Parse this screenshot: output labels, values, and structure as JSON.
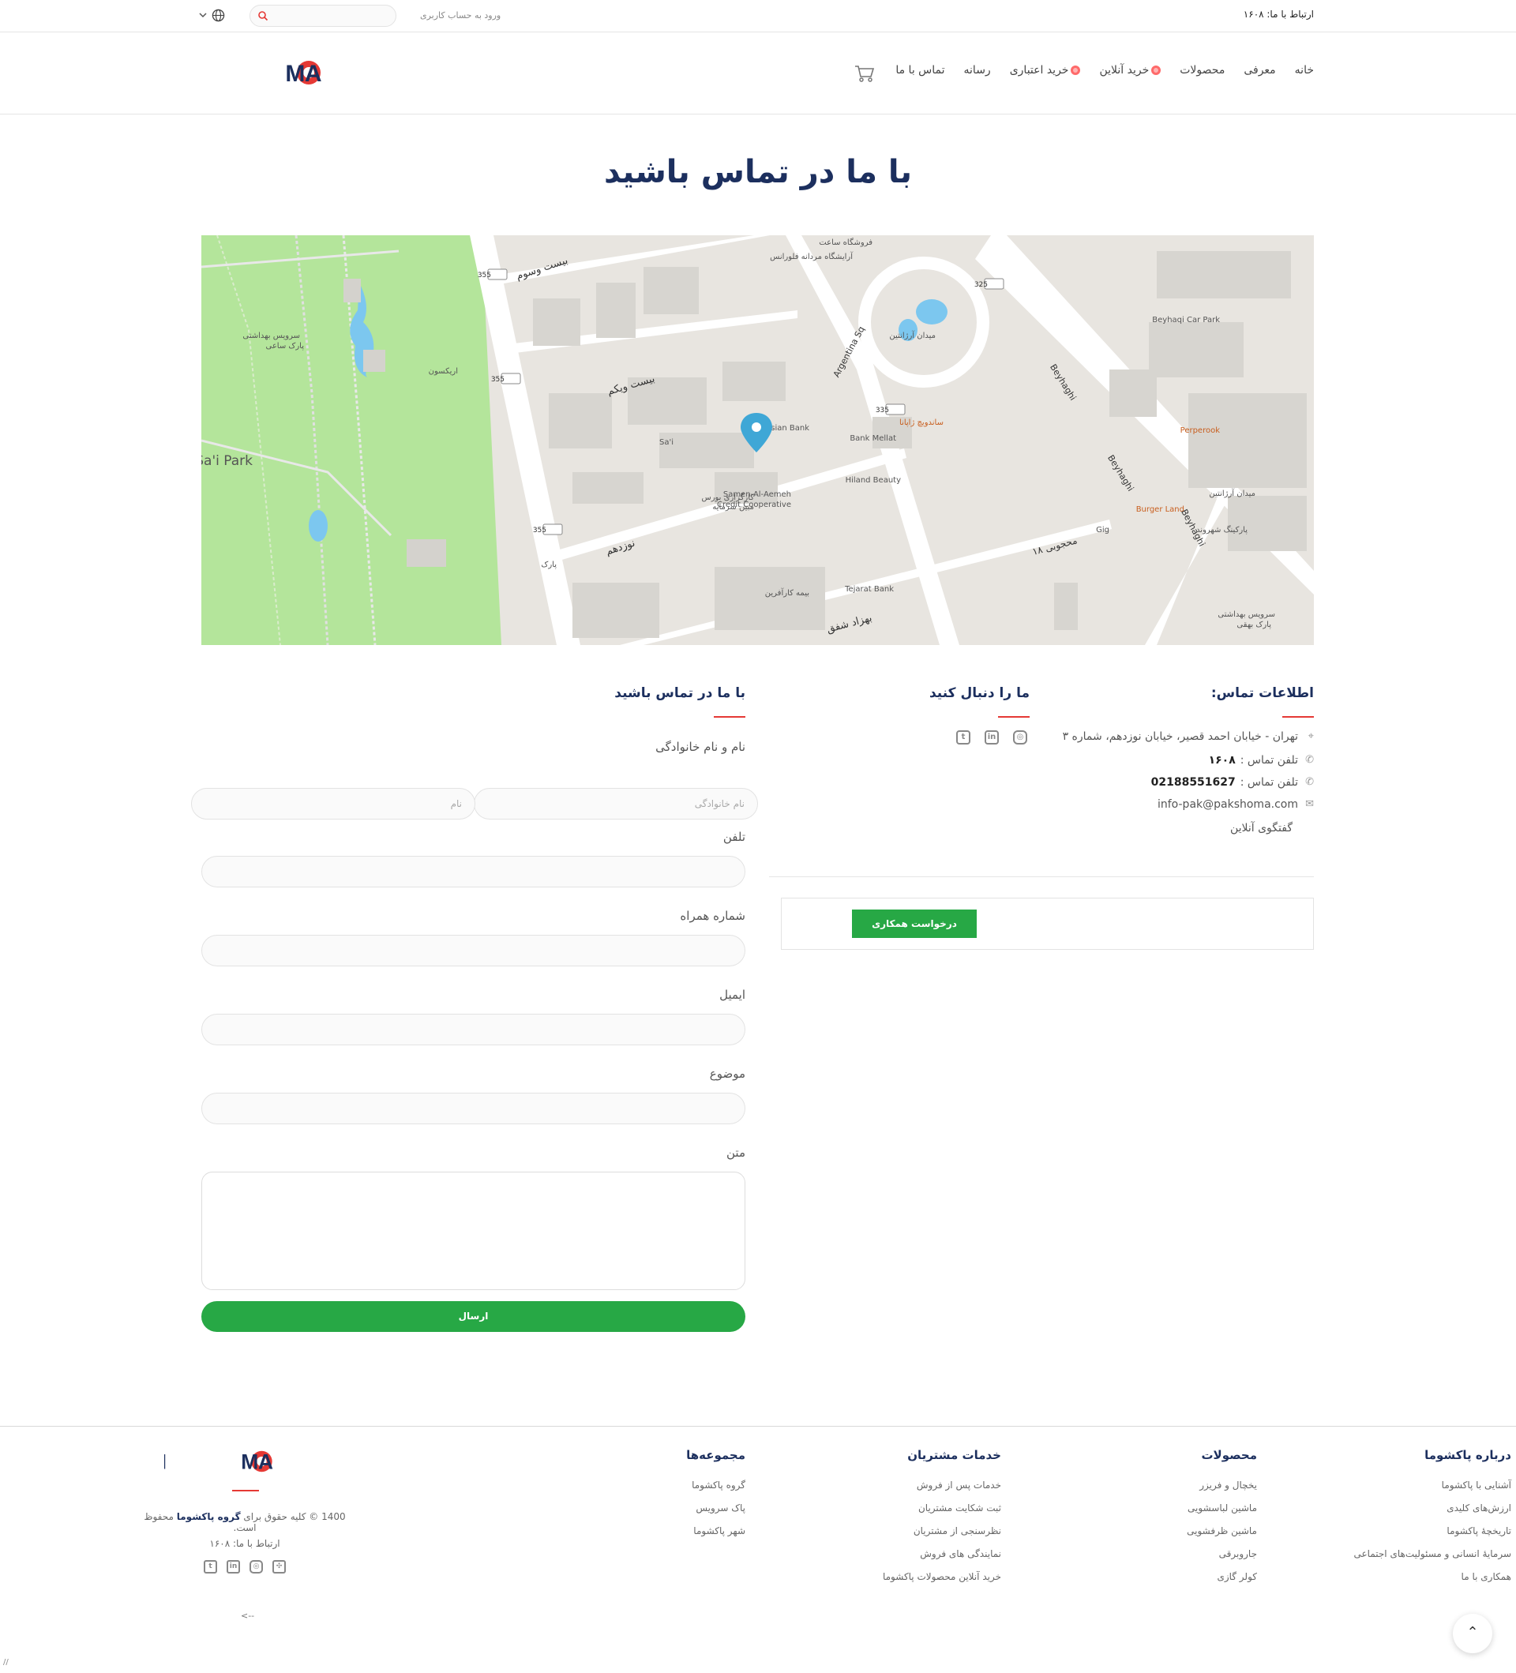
{
  "topbar": {
    "contact": "ارتباط با ما: ۱۶۰۸",
    "login": "ورود به حساب کاربری",
    "search_placeholder": ""
  },
  "nav": {
    "items": [
      "خانه",
      "معرفی",
      "محصولات",
      "خرید آنلاین",
      "خرید اعتباری",
      "رسانه",
      "تماس با ما"
    ],
    "brand": "PAKSHOMA"
  },
  "page_title": "با ما در تماس باشید",
  "map": {
    "labels": {
      "sai_park": "Sa'i Park",
      "sai": "Sa'i",
      "parsian": "Parsian Bank",
      "mellat": "Bank Mellat",
      "hiland": "Hiland Beauty",
      "samen": "Samen-Al-Aemeh",
      "samen2": "Credit Cooperative",
      "tejarat": "Tejarat Bank",
      "beyhaqi_park": "Beyhaqi Car Park",
      "perperook": "Perperook",
      "burger": "Burger Land",
      "gig": "Gig",
      "argentina": "Argentina Sq",
      "beyhaghi": "Beyhaghi",
      "st20": "بیست وسوم",
      "st21": "بیست ویکم",
      "st19": "نوزدهم",
      "behzad": "بهزاد شفق",
      "mahjubi": "محجوبی ۱۸",
      "meydan": "میدان آرژانتین",
      "park_sai_wc": "سرویس بهداشتی",
      "park_sai_wc2": "پارک ساعی",
      "arikson": "اریکسون",
      "store": "فروشگاه ساعت",
      "hair": "آرایشگاه مردانه فلورانس",
      "sandwich": "ساندویچ ژاپانا",
      "meydan2": "میدان آرژانتین",
      "parking": "پارکینگ شهروند",
      "bourse": "کارگزاری بورس",
      "bourse2": "مبین سرمایه",
      "bime": "بیمه کارآفرین",
      "park": "پارک",
      "wc2": "سرویس بهداشتی",
      "wc2b": "پارک بهقی",
      "r355a": "355",
      "r355b": "355",
      "r355c": "355",
      "r325": "325",
      "r335": "335"
    }
  },
  "contact_info": {
    "heading": "اطلاعات تماس:",
    "address": "تهران - خیابان احمد قصیر، خیابان نوزدهم، شماره ۳",
    "phone1_label": "تلفن تماس :",
    "phone1": "۱۶۰۸",
    "phone2_label": "تلفن تماس :",
    "phone2": "02188551627",
    "email": "info-pak@pakshoma.com",
    "chat": "گفتگوی آنلاین"
  },
  "follow": {
    "heading": "ما را دنبال کنید",
    "icons": [
      "instagram-icon",
      "linkedin-icon",
      "twitter-icon"
    ]
  },
  "coop_button": "درخواست همکاری",
  "form": {
    "heading": "با ما در تماس باشید",
    "name_label": "نام و نام خانوادگی",
    "last_name_placeholder": "نام خانوادگی",
    "first_name_placeholder": "نام",
    "phone_label": "تلفن",
    "mobile_label": "شماره همراه",
    "email_label": "ایمیل",
    "subject_label": "موضوع",
    "text_label": "متن",
    "submit": "ارسال"
  },
  "footer": {
    "col_about": {
      "title": "درباره پاکشوما",
      "items": [
        "آشنایی با پاکشوما",
        "ارزش‌های کلیدی",
        "تاریخچۀ پاکشوما",
        "سرمایۀ انسانی و مسئولیت‌های اجتماعی",
        "همکاری با ما"
      ]
    },
    "col_products": {
      "title": "محصولات",
      "items": [
        "یخچال و فریزر",
        "ماشین لباسشویی",
        "ماشین ظرفشویی",
        "جاروبرقی",
        "کولر گازی"
      ]
    },
    "col_services": {
      "title": "خدمات مشتریان",
      "items": [
        "خدمات پس از فروش",
        "ثبت شکایت مشتریان",
        "نظرسنجی از مشتریان",
        "نمایندگی های فروش",
        "خرید آنلاین محصولات پاکشوما"
      ]
    },
    "col_groups": {
      "title": "مجموعه‌ها",
      "items": [
        "گروه پاکشوما",
        "پاک سرویس",
        "شهر پاکشوما"
      ]
    },
    "brand": "PAKSHOMA",
    "copy_pre": "1400 © کلیه حقوق برای",
    "copy_brand": "گروه پاکشوما",
    "copy_post": "محفوظ است.",
    "contact": "ارتباط با ما: ۱۶۰۸",
    "arrow": "<--",
    "corner": "//"
  },
  "colors": {
    "brand_blue": "#1c2f5e",
    "accent_red": "#e53935",
    "green": "#27a845"
  }
}
